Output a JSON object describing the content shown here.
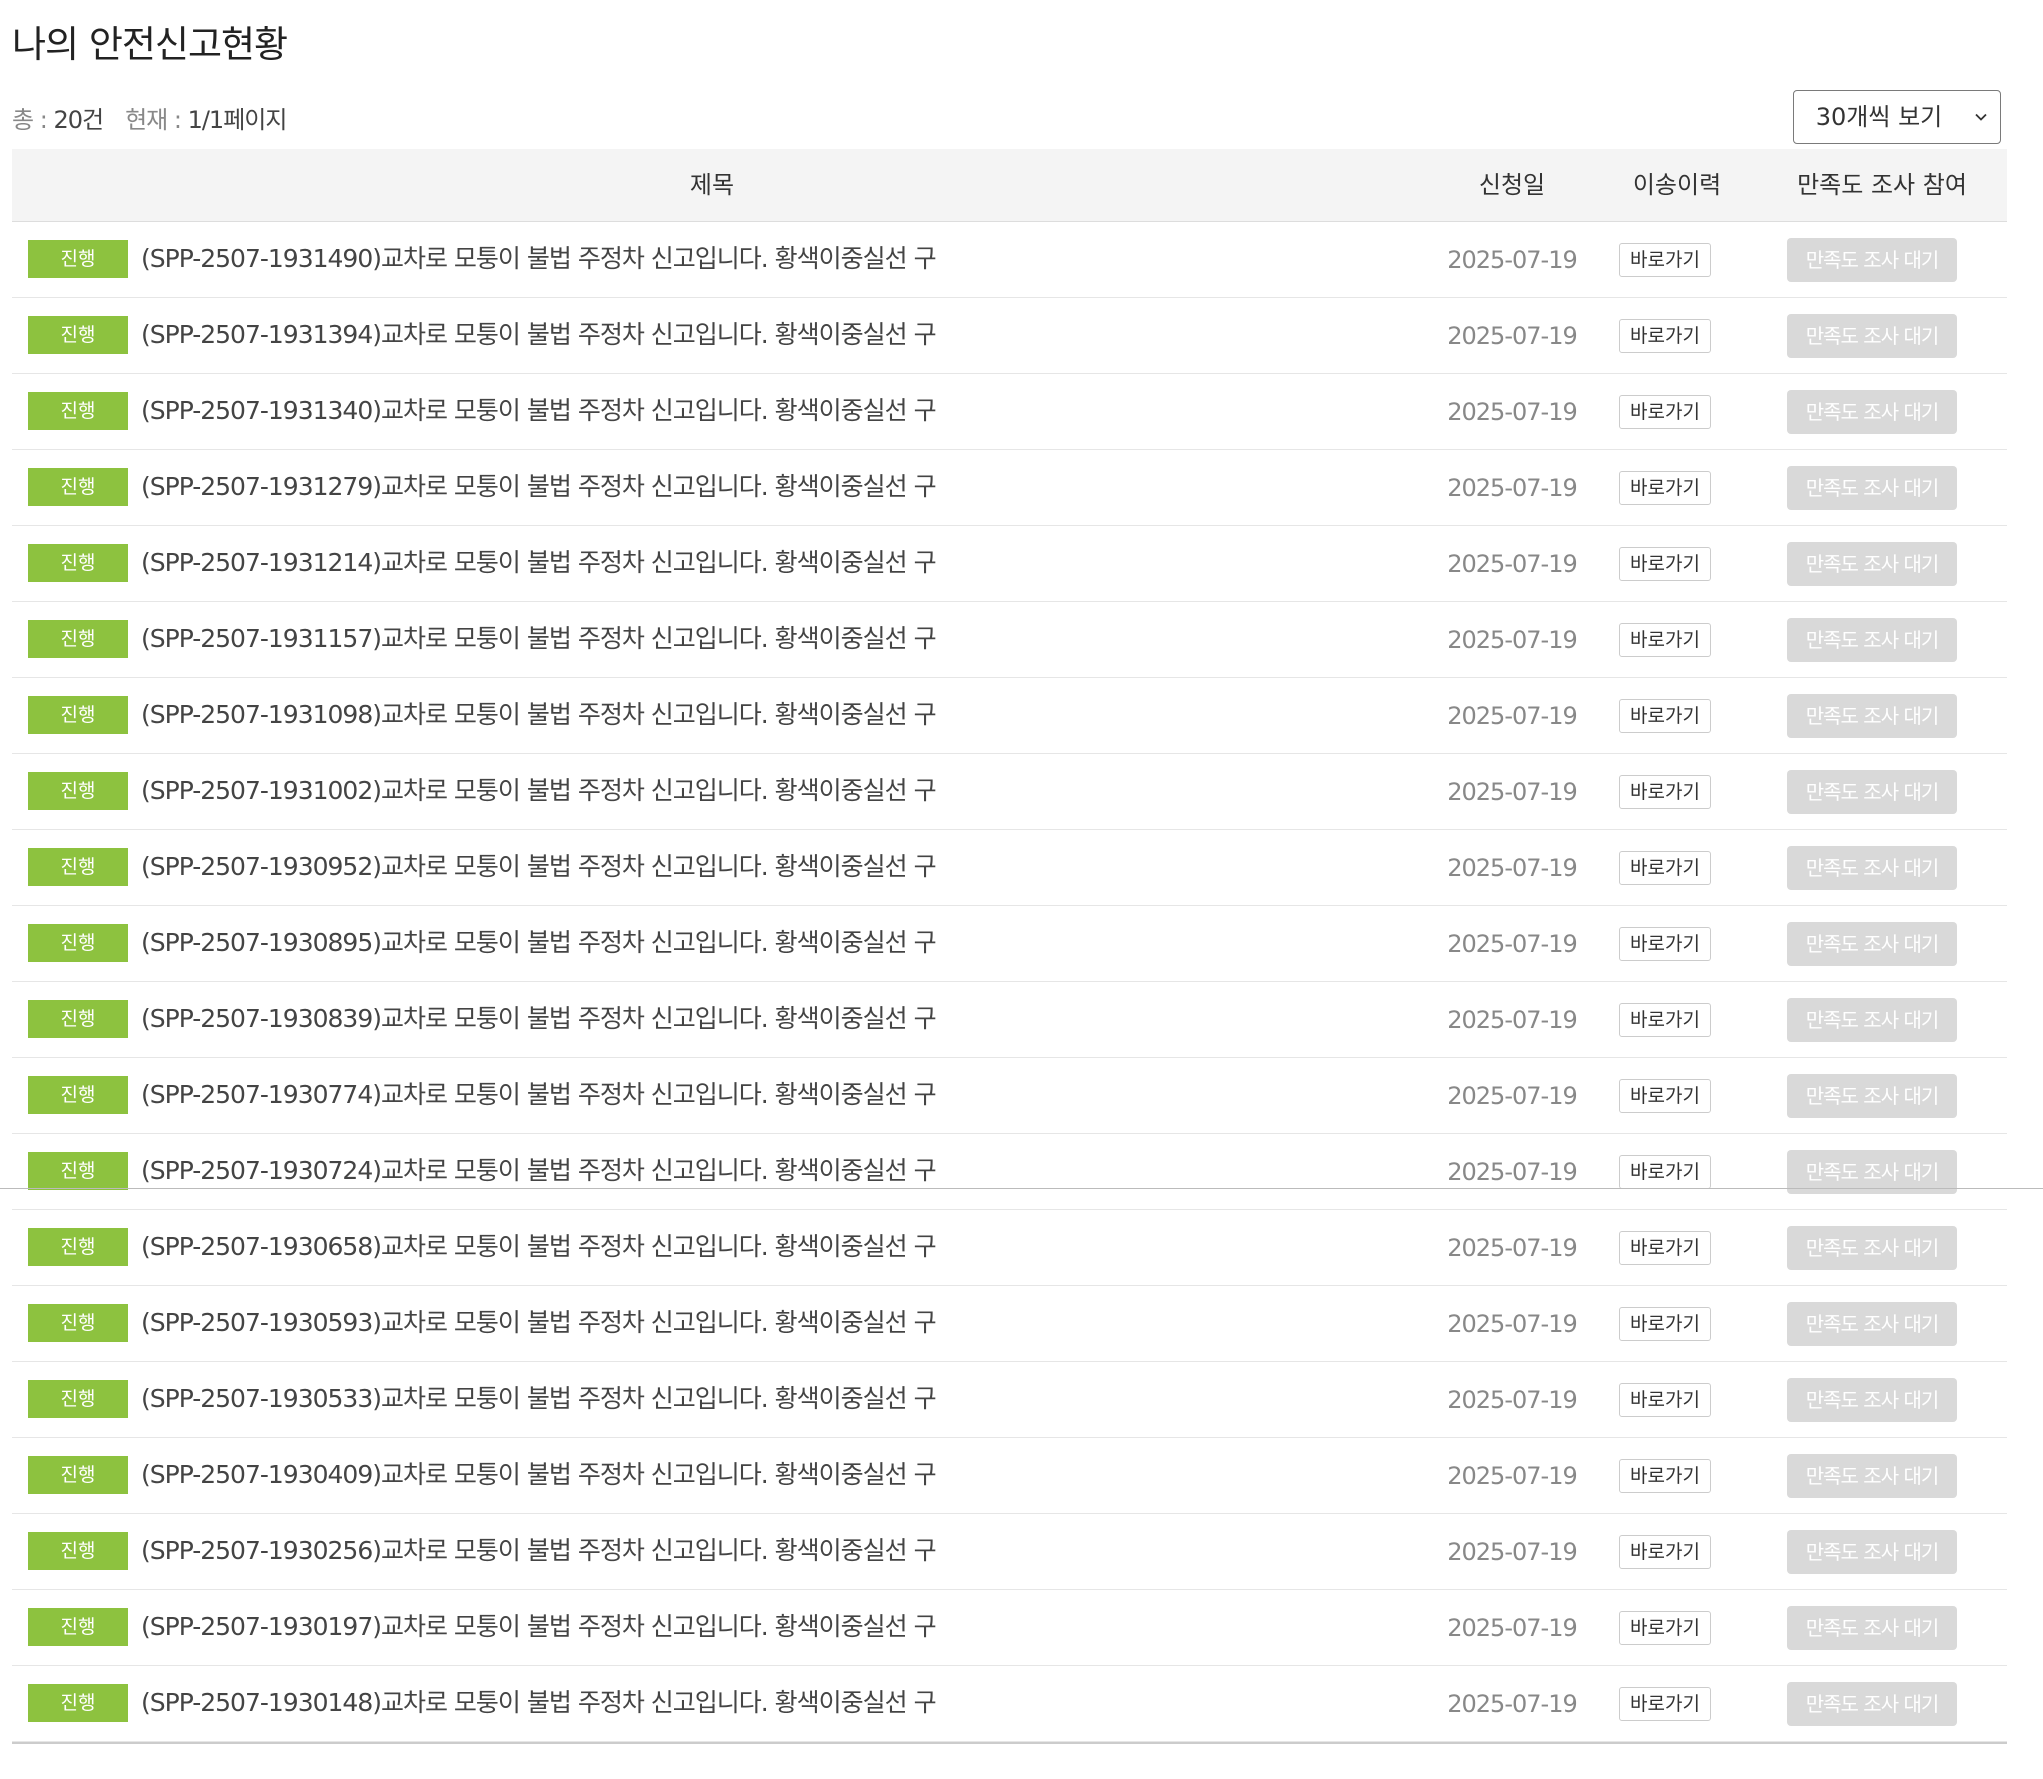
{
  "page": {
    "title": "나의 안전신고현황"
  },
  "summary": {
    "total_label": "총 : ",
    "total_count": "20건",
    "current_label": "현재 : ",
    "current_page": "1/1페이지"
  },
  "page_size": {
    "selected": "30개씩 보기"
  },
  "table": {
    "headers": {
      "title": "제목",
      "date": "신청일",
      "transfer": "이송이력",
      "survey": "만족도 조사 참여"
    },
    "rows": [
      {
        "status": "진행",
        "title": "(SPP-2507-1931490)교차로 모퉁이 불법 주정차 신고입니다. 황색이중실선 구",
        "date": "2025-07-19",
        "transfer": "바로가기",
        "survey": "만족도 조사 대기"
      },
      {
        "status": "진행",
        "title": "(SPP-2507-1931394)교차로 모퉁이 불법 주정차 신고입니다. 황색이중실선 구",
        "date": "2025-07-19",
        "transfer": "바로가기",
        "survey": "만족도 조사 대기"
      },
      {
        "status": "진행",
        "title": "(SPP-2507-1931340)교차로 모퉁이 불법 주정차 신고입니다. 황색이중실선 구",
        "date": "2025-07-19",
        "transfer": "바로가기",
        "survey": "만족도 조사 대기"
      },
      {
        "status": "진행",
        "title": "(SPP-2507-1931279)교차로 모퉁이 불법 주정차 신고입니다. 황색이중실선 구",
        "date": "2025-07-19",
        "transfer": "바로가기",
        "survey": "만족도 조사 대기"
      },
      {
        "status": "진행",
        "title": "(SPP-2507-1931214)교차로 모퉁이 불법 주정차 신고입니다. 황색이중실선 구",
        "date": "2025-07-19",
        "transfer": "바로가기",
        "survey": "만족도 조사 대기"
      },
      {
        "status": "진행",
        "title": "(SPP-2507-1931157)교차로 모퉁이 불법 주정차 신고입니다. 황색이중실선 구",
        "date": "2025-07-19",
        "transfer": "바로가기",
        "survey": "만족도 조사 대기"
      },
      {
        "status": "진행",
        "title": "(SPP-2507-1931098)교차로 모퉁이 불법 주정차 신고입니다. 황색이중실선 구",
        "date": "2025-07-19",
        "transfer": "바로가기",
        "survey": "만족도 조사 대기"
      },
      {
        "status": "진행",
        "title": "(SPP-2507-1931002)교차로 모퉁이 불법 주정차 신고입니다. 황색이중실선 구",
        "date": "2025-07-19",
        "transfer": "바로가기",
        "survey": "만족도 조사 대기"
      },
      {
        "status": "진행",
        "title": "(SPP-2507-1930952)교차로 모퉁이 불법 주정차 신고입니다. 황색이중실선 구",
        "date": "2025-07-19",
        "transfer": "바로가기",
        "survey": "만족도 조사 대기"
      },
      {
        "status": "진행",
        "title": "(SPP-2507-1930895)교차로 모퉁이 불법 주정차 신고입니다. 황색이중실선 구",
        "date": "2025-07-19",
        "transfer": "바로가기",
        "survey": "만족도 조사 대기"
      },
      {
        "status": "진행",
        "title": "(SPP-2507-1930839)교차로 모퉁이 불법 주정차 신고입니다. 황색이중실선 구",
        "date": "2025-07-19",
        "transfer": "바로가기",
        "survey": "만족도 조사 대기"
      },
      {
        "status": "진행",
        "title": "(SPP-2507-1930774)교차로 모퉁이 불법 주정차 신고입니다. 황색이중실선 구",
        "date": "2025-07-19",
        "transfer": "바로가기",
        "survey": "만족도 조사 대기"
      },
      {
        "status": "진행",
        "title": "(SPP-2507-1930724)교차로 모퉁이 불법 주정차 신고입니다. 황색이중실선 구",
        "date": "2025-07-19",
        "transfer": "바로가기",
        "survey": "만족도 조사 대기"
      },
      {
        "status": "진행",
        "title": "(SPP-2507-1930658)교차로 모퉁이 불법 주정차 신고입니다. 황색이중실선 구",
        "date": "2025-07-19",
        "transfer": "바로가기",
        "survey": "만족도 조사 대기"
      },
      {
        "status": "진행",
        "title": "(SPP-2507-1930593)교차로 모퉁이 불법 주정차 신고입니다. 황색이중실선 구",
        "date": "2025-07-19",
        "transfer": "바로가기",
        "survey": "만족도 조사 대기"
      },
      {
        "status": "진행",
        "title": "(SPP-2507-1930533)교차로 모퉁이 불법 주정차 신고입니다. 황색이중실선 구",
        "date": "2025-07-19",
        "transfer": "바로가기",
        "survey": "만족도 조사 대기"
      },
      {
        "status": "진행",
        "title": "(SPP-2507-1930409)교차로 모퉁이 불법 주정차 신고입니다. 황색이중실선 구",
        "date": "2025-07-19",
        "transfer": "바로가기",
        "survey": "만족도 조사 대기"
      },
      {
        "status": "진행",
        "title": "(SPP-2507-1930256)교차로 모퉁이 불법 주정차 신고입니다. 황색이중실선 구",
        "date": "2025-07-19",
        "transfer": "바로가기",
        "survey": "만족도 조사 대기"
      },
      {
        "status": "진행",
        "title": "(SPP-2507-1930197)교차로 모퉁이 불법 주정차 신고입니다. 황색이중실선 구",
        "date": "2025-07-19",
        "transfer": "바로가기",
        "survey": "만족도 조사 대기"
      },
      {
        "status": "진행",
        "title": "(SPP-2507-1930148)교차로 모퉁이 불법 주정차 신고입니다. 황색이중실선 구",
        "date": "2025-07-19",
        "transfer": "바로가기",
        "survey": "만족도 조사 대기"
      }
    ]
  },
  "icons": {
    "select_arrow": "chevron-down-icon"
  },
  "colors": {
    "status_badge": "#8dc23f",
    "survey_disabled": "#d9d9d9",
    "header_bg": "#f4f4f4"
  }
}
